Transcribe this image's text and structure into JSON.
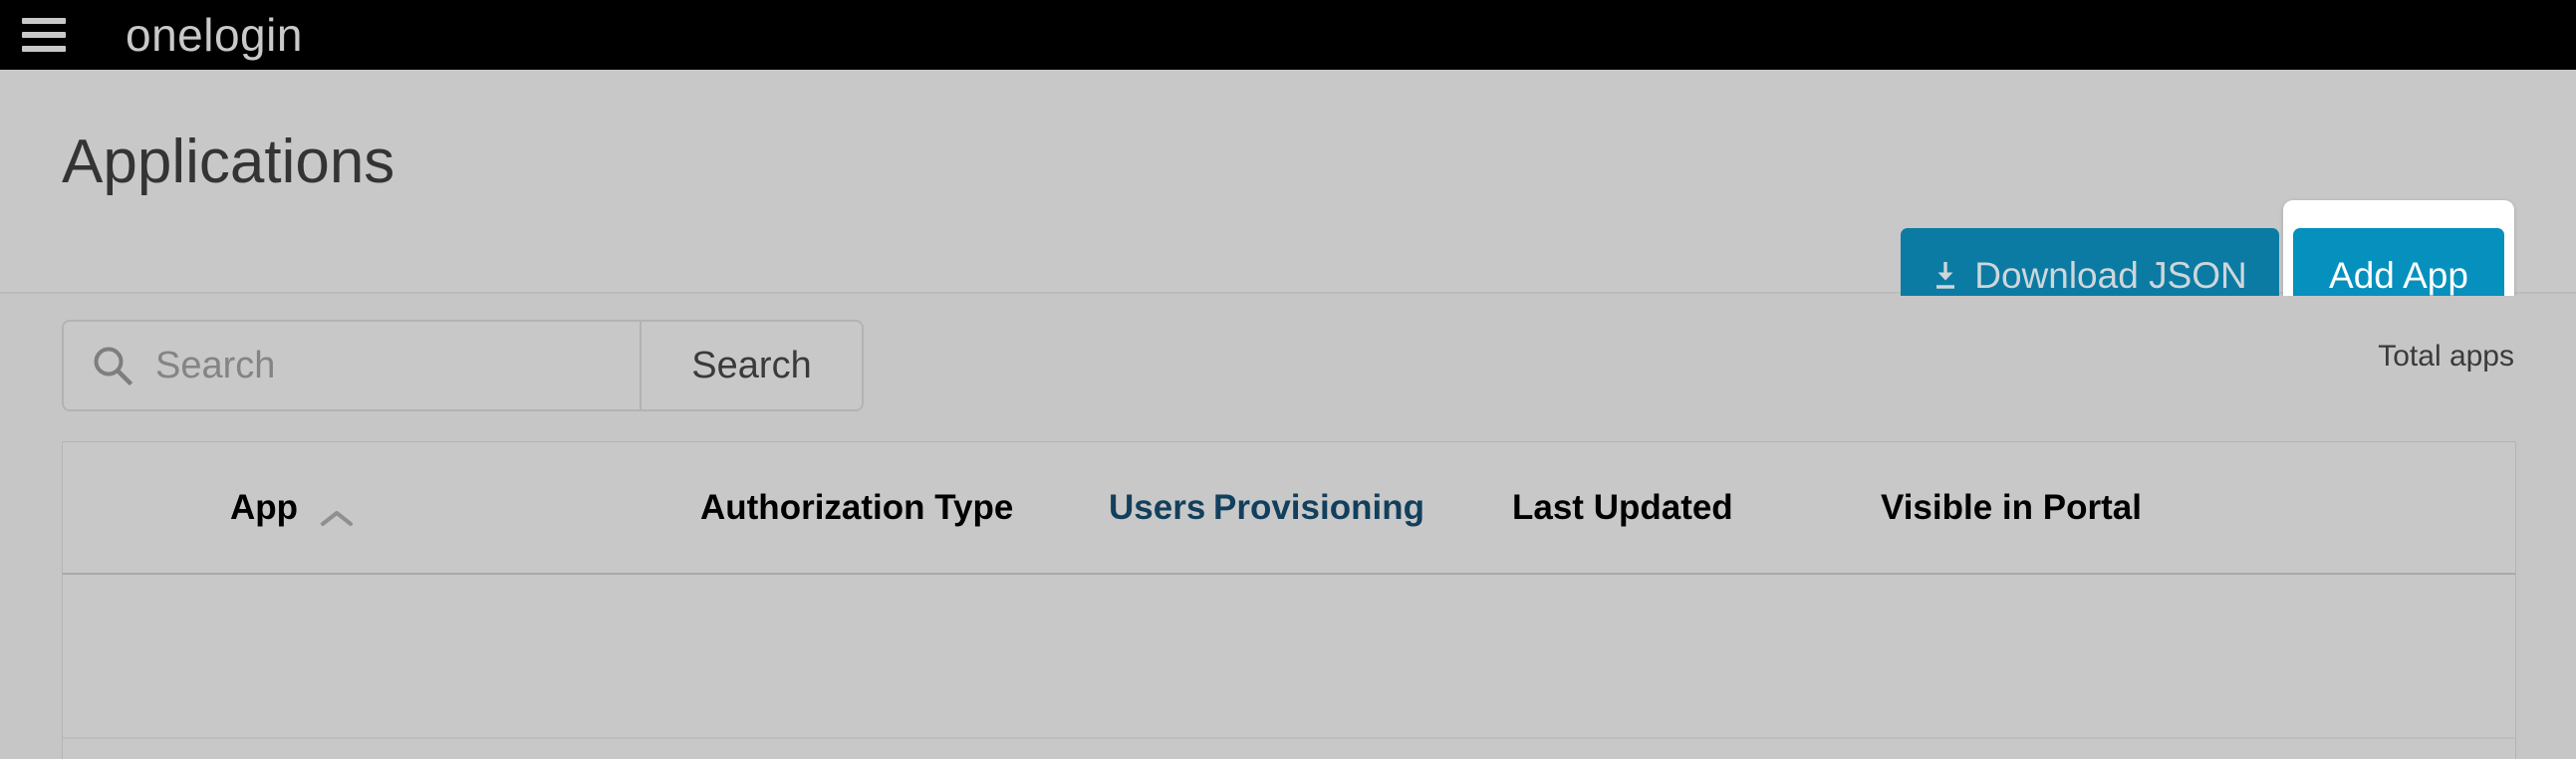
{
  "topbar": {
    "menu_icon": "hamburger-menu-icon",
    "brand": "onelogin"
  },
  "title_band": {
    "page_title": "Applications",
    "download_button": {
      "icon": "download-icon",
      "label": "Download JSON",
      "color": "#0b7ba3"
    },
    "add_app_button": {
      "label": "Add App",
      "color": "#0690bd",
      "focus_ring_color": "#ffffff"
    }
  },
  "search_band": {
    "search_icon": "search-icon",
    "search_input_value": "",
    "search_placeholder": "Search",
    "search_button_label": "Search",
    "total_apps_label": "Total apps"
  },
  "table": {
    "columns": [
      {
        "label": "App",
        "sort_icon": "chevron-up-icon",
        "sorted": true,
        "is_link": false
      },
      {
        "label": "Authorization Type",
        "is_link": false
      },
      {
        "label": "Users",
        "is_link": true
      },
      {
        "label": "Provisioning",
        "is_link": true
      },
      {
        "label": "Last Updated",
        "is_link": false
      },
      {
        "label": "Visible in Portal",
        "is_link": false
      }
    ],
    "rows": []
  },
  "colors": {
    "page_background": "#c6c6c6",
    "topbar_background": "#000000",
    "link_blue": "#123f5c",
    "primary_blue": "#0690bd",
    "secondary_blue": "#0b7ba3"
  }
}
